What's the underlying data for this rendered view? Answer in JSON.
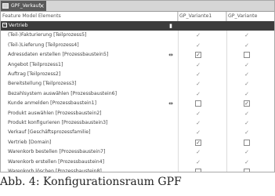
{
  "tab": {
    "label": "GPF_Verkauf",
    "close": "×"
  },
  "columns": {
    "elements": "Feature Model Elements",
    "variant1": "GP_Variante1",
    "variant2": "GP_Variante"
  },
  "root": {
    "label": "Vertrieb",
    "expander": "−"
  },
  "rows": [
    {
      "label": "(Teil-)Fakturierung [Teilprozess5]",
      "icon": "",
      "v1": "check",
      "v2": "check"
    },
    {
      "label": "(Teil-)Lieferung [Teilprozess4]",
      "icon": "",
      "v1": "check",
      "v2": "check"
    },
    {
      "label": "Adressdaten erstellen [Prozessbaustein5]",
      "icon": "⇹",
      "v1": "box-check",
      "v2": "box"
    },
    {
      "label": "Angebot [Teilprozess1]",
      "icon": "",
      "v1": "check",
      "v2": "check"
    },
    {
      "label": "Auftrag [Teilprozess2]",
      "icon": "",
      "v1": "check",
      "v2": "check"
    },
    {
      "label": "Bereitstellung [Teilprozess3]",
      "icon": "",
      "v1": "check",
      "v2": "check"
    },
    {
      "label": "Bezahlsystem auswählen [Prozessbaustein6]",
      "icon": "",
      "v1": "check",
      "v2": "check"
    },
    {
      "label": "Kunde anmelden [Prozessbaustein1]",
      "icon": "⇹",
      "v1": "box",
      "v2": "box-check"
    },
    {
      "label": "Produkt auswählen [Prozessbaustein2]",
      "icon": "",
      "v1": "check",
      "v2": "check"
    },
    {
      "label": "Produkt konfigurieren [Prozessbaustein3]",
      "icon": "",
      "v1": "check",
      "v2": "check"
    },
    {
      "label": "Verkauf [Geschäftsprozessfamilie]",
      "icon": "",
      "v1": "check",
      "v2": "check"
    },
    {
      "label": "Vertrieb [Domain]",
      "icon": "",
      "v1": "box-check",
      "v2": "box"
    },
    {
      "label": "Warenkorb bestellen [Prozessbaustein7]",
      "icon": "",
      "v1": "check",
      "v2": "check"
    },
    {
      "label": "Warenkorb erstellen [Prozessbaustein4]",
      "icon": "",
      "v1": "check",
      "v2": "check"
    },
    {
      "label": "Warenkorb löschen [Prozessbaustein8]",
      "icon": "",
      "v1": "box",
      "v2": "box"
    }
  ],
  "caption": "Abb. 4: Konfigurationsraum GPF"
}
